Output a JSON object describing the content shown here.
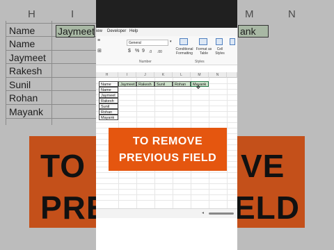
{
  "background": {
    "column_headers": [
      "H",
      "I",
      "M",
      "N"
    ],
    "col_a_values": [
      "Name",
      "Name",
      "Jaymeet",
      "Rakesh",
      "Sunil",
      "Rohan",
      "Mayank"
    ],
    "row1_second_cell": "Jaymeet",
    "right_cell_fragment": "ank",
    "banner_line1_fragment_left": "TO",
    "banner_line1_fragment_right": "VE",
    "banner_line2_fragment_left": "PRE",
    "banner_line2_fragment_right": "ELD"
  },
  "menu": {
    "items": [
      "iew",
      "Developer",
      "Help"
    ]
  },
  "ribbon": {
    "font_name": "General",
    "currency_symbol": "$",
    "percent_symbol": "%",
    "comma_symbol": "9",
    "dec_inc": ".0",
    "dec_dec": ".00",
    "conditional_label": "Conditional\nFormatting",
    "format_table_label": "Format as\nTable",
    "cell_styles_label": "Cell\nStyles",
    "group_number": "Number",
    "group_styles": "Styles"
  },
  "sheet": {
    "column_headers": [
      "H",
      "I",
      "J",
      "K",
      "L",
      "M",
      "N"
    ],
    "header_row": [
      "Name",
      "Jaymeet",
      "Rakesh",
      "Sunil",
      "Rohan",
      "Mayank"
    ],
    "names": [
      "Name",
      "Jaymeet",
      "Rakesh",
      "Sunil",
      "Rohan",
      "Mayank"
    ]
  },
  "caption": {
    "line1": "TO REMOVE",
    "line2": "PREVIOUS FIELD"
  },
  "colors": {
    "caption_bg": "#e5560f",
    "highlight_cell": "#cfe3cc",
    "excel_green": "#217346"
  }
}
